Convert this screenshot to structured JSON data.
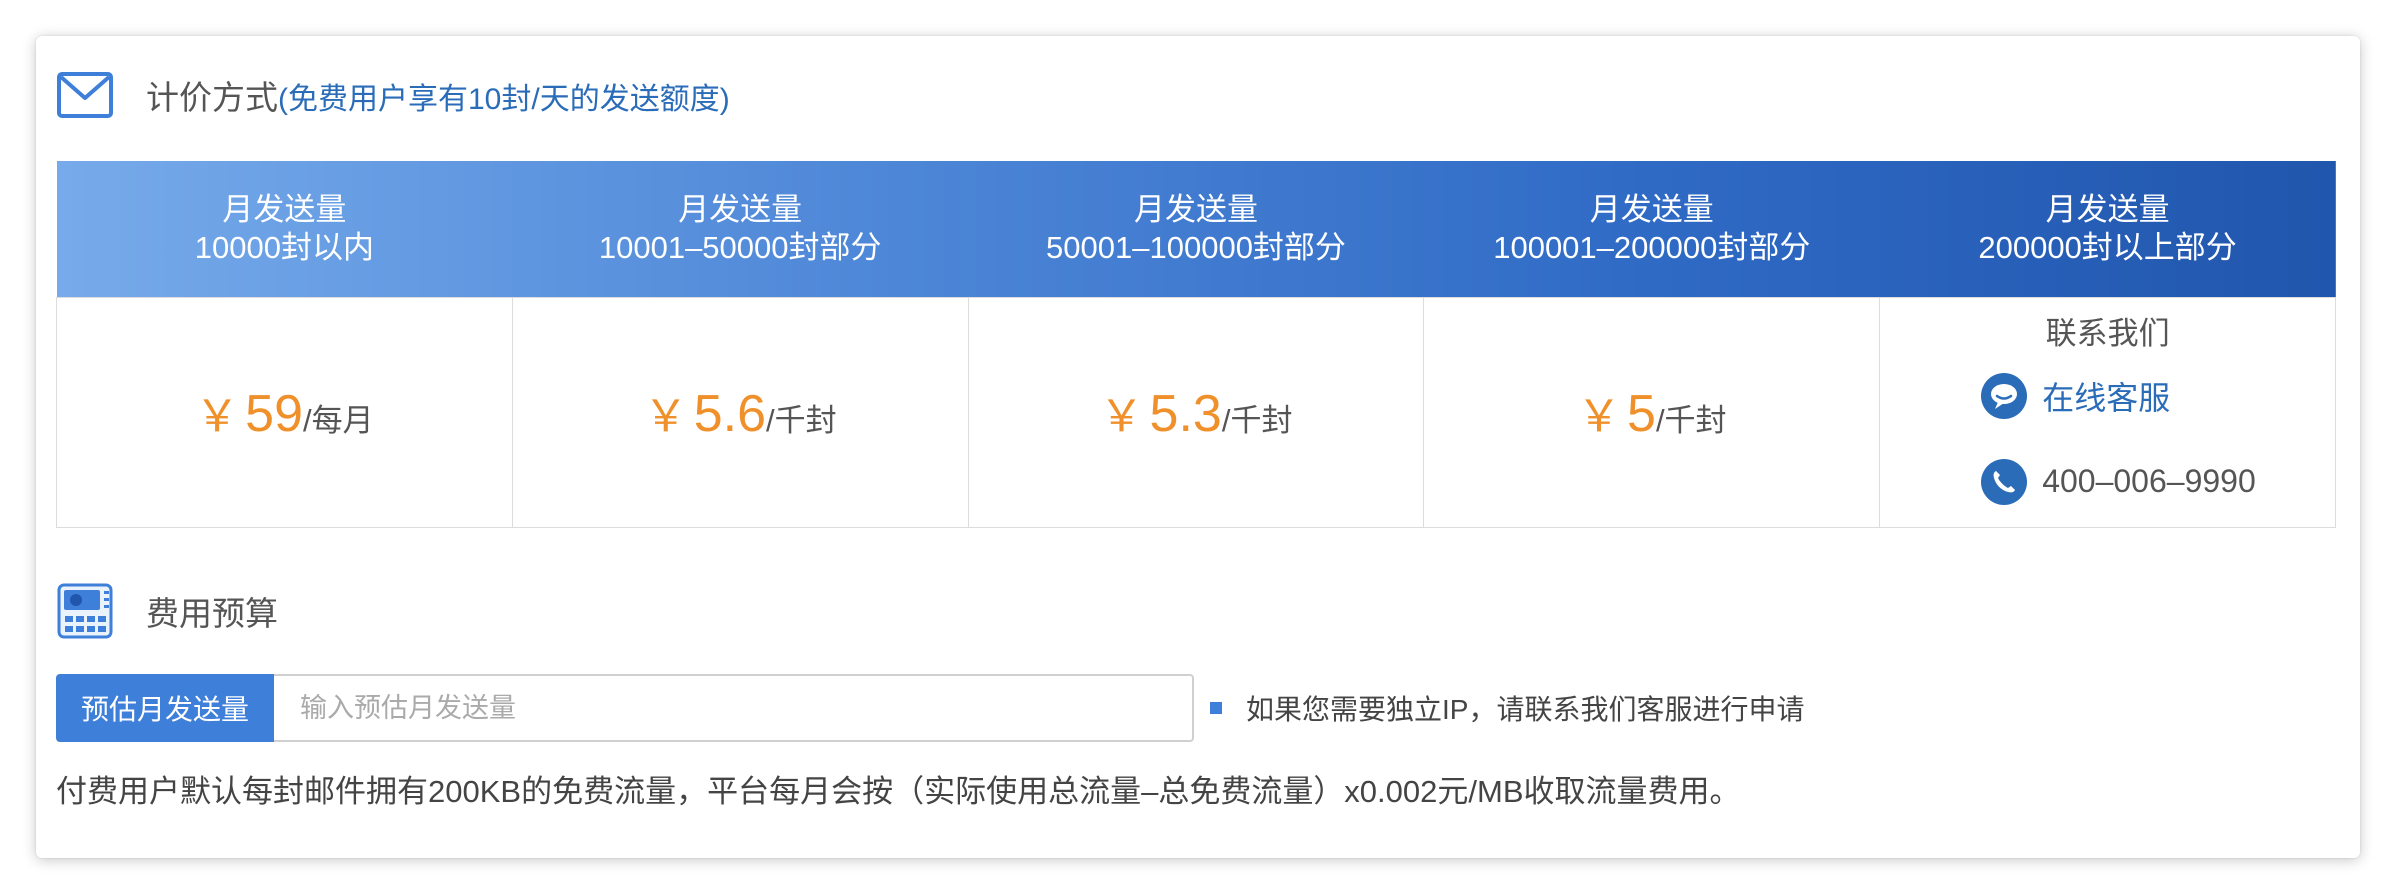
{
  "pricing": {
    "title": "计价方式",
    "note": "(免费用户享有10封/天的发送额度)",
    "tiers": [
      {
        "label": "月发送量",
        "range": "10000封以内",
        "currency": "￥",
        "price": "59",
        "unit": "/每月"
      },
      {
        "label": "月发送量",
        "range": "10001–50000封部分",
        "currency": "￥",
        "price": "5.6",
        "unit": "/千封"
      },
      {
        "label": "月发送量",
        "range": "50001–100000封部分",
        "currency": "￥",
        "price": "5.3",
        "unit": "/千封"
      },
      {
        "label": "月发送量",
        "range": "100001–200000封部分",
        "currency": "￥",
        "price": "5",
        "unit": "/千封"
      },
      {
        "label": "月发送量",
        "range": "200000封以上部分"
      }
    ],
    "contact": {
      "title": "联系我们",
      "chat_label": "在线客服",
      "phone": "400–006–9990"
    }
  },
  "budget": {
    "title": "费用预算",
    "estimate_button": "预估月发送量",
    "input_placeholder": "输入预估月发送量",
    "input_value": "",
    "ip_note": "如果您需要独立IP，请联系我们客服进行申请",
    "footnote": "付费用户默认每封邮件拥有200KB的免费流量，平台每月会按（实际使用总流量–总免费流量）x0.002元/MB收取流量费用。"
  },
  "icons": {
    "pricing": "mail-icon",
    "budget": "calculator-icon",
    "chat": "chat-bubble-icon",
    "phone": "phone-icon"
  },
  "colors": {
    "accent": "#3d7fd9",
    "price": "#f0902a",
    "link": "#2a6cb8"
  }
}
